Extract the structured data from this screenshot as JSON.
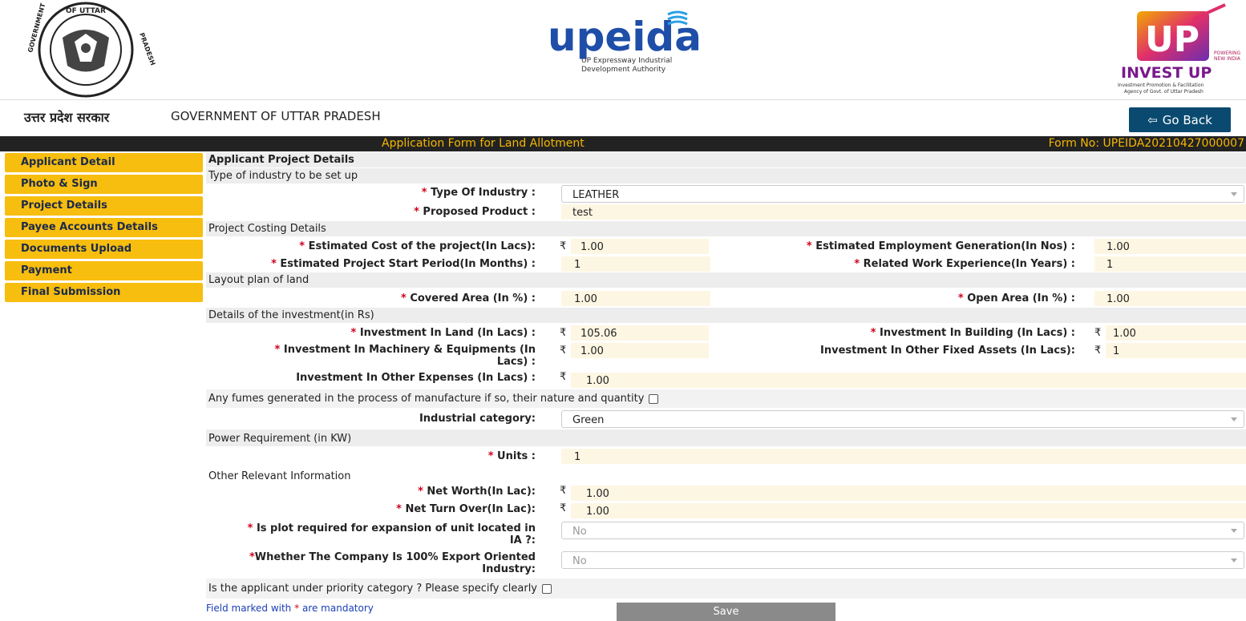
{
  "header": {
    "emblem_text": "GOVERNMENT OF UTTAR PRADESH",
    "upeida_name": "upeida",
    "upeida_sub1": "UP Expressway Industrial",
    "upeida_sub2": "Development Authority",
    "investup_tag1": "POWERING",
    "investup_tag2": "NEW INDIA",
    "investup_name": "INVEST UP",
    "investup_sub1": "Investment Promotion & Facilitation",
    "investup_sub2": "Agency of Govt. of Uttar Pradesh"
  },
  "govbar": {
    "hindi": "उत्तर प्रदेश सरकार",
    "english": "GOVERNMENT OF UTTAR PRADESH",
    "back_arrow": "⇦",
    "back_label": "Go Back"
  },
  "titlebar": {
    "title": "Application Form for Land Allotment",
    "form_no": "Form No: UPEIDA20210427000007"
  },
  "sidebar": {
    "items": [
      {
        "label": "Applicant Detail"
      },
      {
        "label": "Photo & Sign"
      },
      {
        "label": "Project Details"
      },
      {
        "label": "Payee Accounts Details"
      },
      {
        "label": "Documents Upload"
      },
      {
        "label": "Payment"
      },
      {
        "label": "Final Submission"
      }
    ]
  },
  "form": {
    "heading": "Applicant Project Details",
    "sec_industry": "Type of industry to be set up",
    "type_of_industry_label": "Type Of Industry :",
    "type_of_industry_value": "LEATHER",
    "proposed_product_label": "Proposed Product :",
    "proposed_product_value": "test",
    "sec_costing": "Project Costing Details",
    "est_cost_label": "Estimated Cost of the project(In Lacs):",
    "est_cost_value": "1.00",
    "est_emp_label": "Estimated Employment Generation(In Nos) :",
    "est_emp_value": "1.00",
    "start_period_label": "Estimated Project Start Period(In Months) :",
    "start_period_value": "1",
    "work_exp_label": "Related Work Experience(In Years) :",
    "work_exp_value": "1",
    "sec_layout": "Layout plan of land",
    "covered_label": "Covered Area (In %) :",
    "covered_value": "1.00",
    "open_label": "Open Area  (In %) :",
    "open_value": "1.00",
    "sec_invest": "Details of the investment(in Rs)",
    "inv_land_label": "Investment In Land (In Lacs) :",
    "inv_land_value": "105.06",
    "inv_building_label": "Investment In Building (In Lacs) :",
    "inv_building_value": "1.00",
    "inv_machinery_label1": "Investment In Machinery & Equipments (In",
    "inv_machinery_label2": "Lacs) :",
    "inv_machinery_value": "1.00",
    "inv_other_fixed_label": "Investment In Other Fixed Assets (In Lacs):",
    "inv_other_fixed_value": "1",
    "inv_other_exp_label": "Investment In Other Expenses (In Lacs) :",
    "inv_other_exp_value": "1.00",
    "fumes_label": "Any fumes generated in the process of manufacture if so, their nature and quantity",
    "ind_category_label": "Industrial category:",
    "ind_category_value": "Green",
    "sec_power": "Power Requirement (in KW)",
    "units_label": "Units  :",
    "units_value": "1",
    "sec_other": "Other Relevant Information",
    "net_worth_label": "Net Worth(In Lac):",
    "net_worth_value": "1.00",
    "net_turnover_label": "Net Turn Over(In Lac):",
    "net_turnover_value": "1.00",
    "plot_expansion_label1": "Is plot required for expansion of unit located in",
    "plot_expansion_label2": "IA ?:",
    "plot_expansion_value": "No",
    "export_label1": "Whether The Company Is 100% Export Oriented",
    "export_label2": "Industry:",
    "export_value": "No",
    "priority_label": "Is the applicant under priority category ? Please specify clearly",
    "mandatory_note_pre": "Field marked with",
    "mandatory_note_post": "are mandatory",
    "save_label": "Save",
    "required_mark": "*",
    "rupee": "₹"
  },
  "colors": {
    "sidebar_bg": "#f7bd0f",
    "titlebar_bg": "#222222",
    "titlebar_text": "#f5b700",
    "goback_bg": "#0a4a70",
    "field_bg": "#fdf6e3",
    "required": "#d0021b"
  }
}
